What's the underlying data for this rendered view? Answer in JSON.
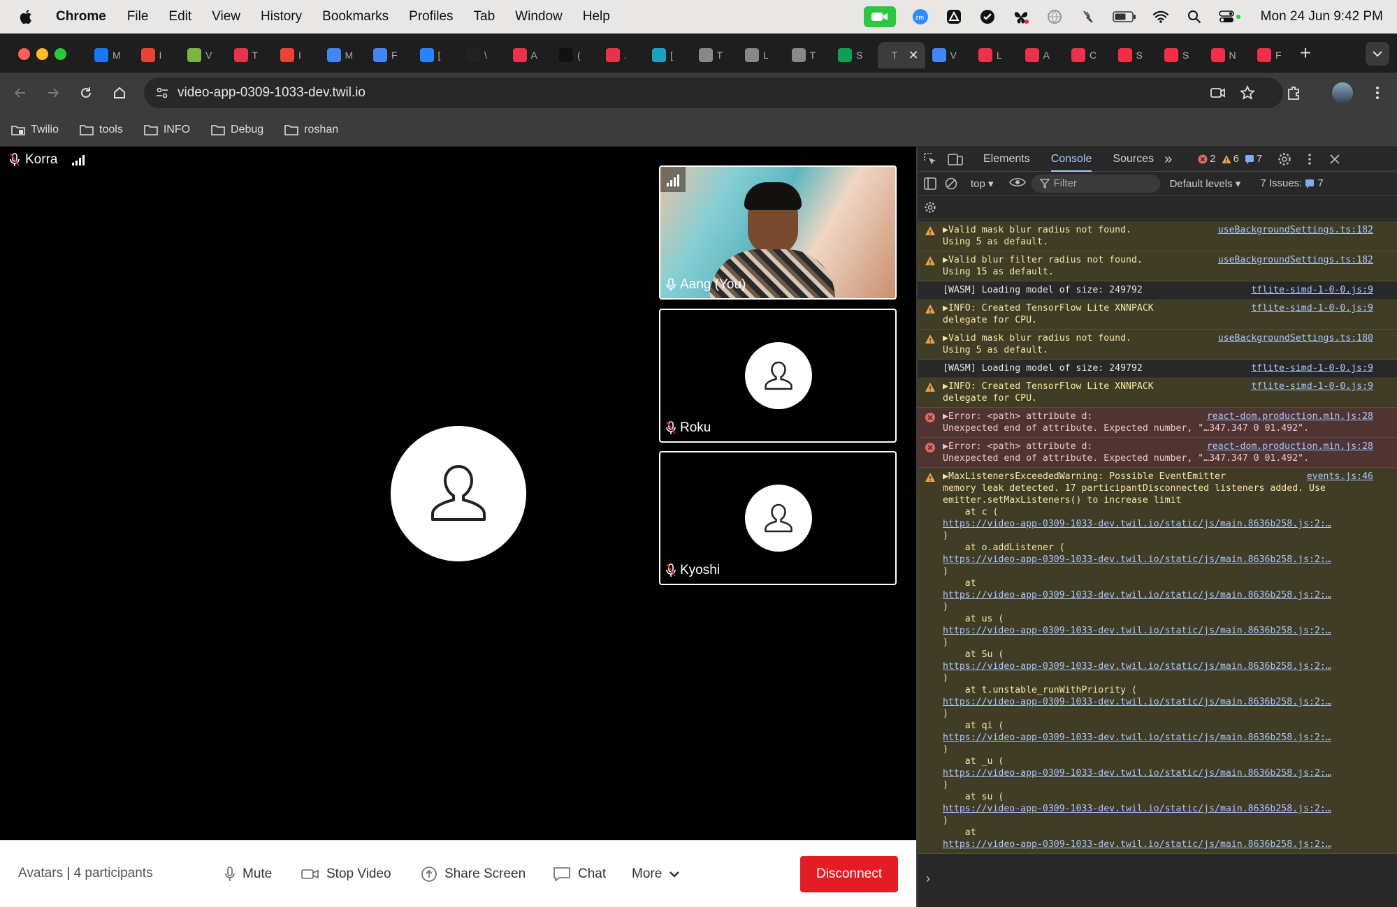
{
  "menubar": {
    "app_name": "Chrome",
    "items": [
      "File",
      "Edit",
      "View",
      "History",
      "Bookmarks",
      "Profiles",
      "Tab",
      "Window",
      "Help"
    ],
    "clock": "Mon 24 Jun  9:42 PM"
  },
  "tabs": [
    {
      "title": "M",
      "icon": "meta-icon",
      "color": "#1877f2"
    },
    {
      "title": "I",
      "icon": "gmail-icon",
      "color": "#ea4335"
    },
    {
      "title": "V",
      "icon": "pen-icon",
      "color": "#7cb342"
    },
    {
      "title": "T",
      "icon": "target-icon",
      "color": "#e8334a"
    },
    {
      "title": "I",
      "icon": "gmail-icon",
      "color": "#ea4335"
    },
    {
      "title": "M",
      "icon": "docs-icon",
      "color": "#4285f4"
    },
    {
      "title": "F",
      "icon": "docs-icon",
      "color": "#4285f4"
    },
    {
      "title": "[",
      "icon": "jira-icon",
      "color": "#2684ff"
    },
    {
      "title": "\\",
      "icon": "k-icon",
      "color": "#222222"
    },
    {
      "title": "A",
      "icon": "target-icon",
      "color": "#e8334a"
    },
    {
      "title": "(",
      "icon": "github-icon",
      "color": "#111111"
    },
    {
      "title": ".",
      "icon": "target-icon",
      "color": "#e8334a"
    },
    {
      "title": "[",
      "icon": "calendar-icon",
      "color": "#1da1c1"
    },
    {
      "title": "T",
      "icon": "globe-icon",
      "color": "#888888"
    },
    {
      "title": "L",
      "icon": "globe-icon",
      "color": "#888888"
    },
    {
      "title": "T",
      "icon": "globe-icon",
      "color": "#888888"
    },
    {
      "title": "S",
      "icon": "sheets-icon",
      "color": "#0f9d58"
    },
    {
      "title": "T",
      "icon": "",
      "color": "#3c3c3c",
      "active": true
    },
    {
      "title": "V",
      "icon": "docs-icon",
      "color": "#4285f4"
    },
    {
      "title": "L",
      "icon": "target-icon",
      "color": "#e8334a"
    },
    {
      "title": "A",
      "icon": "target-icon",
      "color": "#e8334a"
    },
    {
      "title": "C",
      "icon": "target-icon",
      "color": "#e8334a"
    },
    {
      "title": "S",
      "icon": "twilio-icon",
      "color": "#f22f46"
    },
    {
      "title": "S",
      "icon": "twilio-icon",
      "color": "#f22f46"
    },
    {
      "title": "N",
      "icon": "twilio-icon",
      "color": "#f22f46"
    },
    {
      "title": "F",
      "icon": "twilio-icon",
      "color": "#f22f46"
    }
  ],
  "omnibox": {
    "url": "video-app-0309-1033-dev.twil.io"
  },
  "bookmarks": [
    {
      "label": "Twilio",
      "icon": "folder-group-icon"
    },
    {
      "label": "tools",
      "icon": "folder-icon"
    },
    {
      "label": "INFO",
      "icon": "folder-icon"
    },
    {
      "label": "Debug",
      "icon": "folder-icon"
    },
    {
      "label": "roshan",
      "icon": "folder-icon"
    }
  ],
  "room": {
    "self_name": "Korra",
    "participants": [
      {
        "name": "Aang (You)",
        "video": true
      },
      {
        "name": "Roku",
        "video": false
      },
      {
        "name": "Kyoshi",
        "video": false
      }
    ],
    "room_name": "Avatars",
    "participant_count": "4 participants"
  },
  "controls": {
    "mute": "Mute",
    "stop_video": "Stop Video",
    "share_screen": "Share Screen",
    "chat": "Chat",
    "more": "More",
    "disconnect": "Disconnect"
  },
  "colors": {
    "disconnect": "#e31c25",
    "devtools_accent": "#a8c7fa"
  },
  "devtools": {
    "tabs": [
      "Elements",
      "Console",
      "Sources"
    ],
    "active_tab": "Console",
    "error_count": "2",
    "warning_count": "6",
    "info_count": "7",
    "context": "top",
    "filter_placeholder": "Filter",
    "levels": "Default levels",
    "issues_label": "7 Issues:",
    "issues_count": "7",
    "logs": [
      {
        "level": "warn",
        "msg": "▶Valid mask blur radius not found.\nUsing 5 as default.",
        "src": "useBackgroundSettings.ts:182"
      },
      {
        "level": "warn",
        "msg": "▶Valid blur filter radius not found.\nUsing 15 as default.",
        "src": "useBackgroundSettings.ts:182"
      },
      {
        "level": "info",
        "msg": "[WASM] Loading model of size: 249792",
        "src": "tflite-simd-1-0-0.js:9"
      },
      {
        "level": "warn",
        "msg": "▶INFO: Created TensorFlow Lite XNNPACK\ndelegate for CPU.",
        "src": "tflite-simd-1-0-0.js:9"
      },
      {
        "level": "warn",
        "msg": "▶Valid mask blur radius not found.\nUsing 5 as default.",
        "src": "useBackgroundSettings.ts:180"
      },
      {
        "level": "info",
        "msg": "[WASM] Loading model of size: 249792",
        "src": "tflite-simd-1-0-0.js:9"
      },
      {
        "level": "warn",
        "msg": "▶INFO: Created TensorFlow Lite XNNPACK\ndelegate for CPU.",
        "src": "tflite-simd-1-0-0.js:9"
      },
      {
        "level": "err",
        "msg": "▶Error: <path> attribute d:\nUnexpected end of attribute. Expected number, \"…347.347 0 01.492\".",
        "src": "react-dom.production.min.js:28"
      },
      {
        "level": "err",
        "msg": "▶Error: <path> attribute d:\nUnexpected end of attribute. Expected number, \"…347.347 0 01.492\".",
        "src": "react-dom.production.min.js:28"
      },
      {
        "level": "warn",
        "msg": "▶MaxListenersExceededWarning: Possible EventEmitter\nmemory leak detected. 17 participantDisconnected listeners added. Use\nemitter.setMaxListeners() to increase limit",
        "src": "events.js:46",
        "stack": [
          {
            "at": "    at c (",
            "url": "https://video-app-0309-1033-dev.twil.io/static/js/main.8636b258.js:2:…"
          },
          {
            "at": "    at o.addListener (",
            "url": "https://video-app-0309-1033-dev.twil.io/static/js/main.8636b258.js:2:…"
          },
          {
            "at": "    at",
            "url": "https://video-app-0309-1033-dev.twil.io/static/js/main.8636b258.js:2:…"
          },
          {
            "at": "    at us (",
            "url": "https://video-app-0309-1033-dev.twil.io/static/js/main.8636b258.js:2:…"
          },
          {
            "at": "    at Su (",
            "url": "https://video-app-0309-1033-dev.twil.io/static/js/main.8636b258.js:2:…"
          },
          {
            "at": "    at t.unstable_runWithPriority (",
            "url": "https://video-app-0309-1033-dev.twil.io/static/js/main.8636b258.js:2:…"
          },
          {
            "at": "    at qi (",
            "url": "https://video-app-0309-1033-dev.twil.io/static/js/main.8636b258.js:2:…"
          },
          {
            "at": "    at _u (",
            "url": "https://video-app-0309-1033-dev.twil.io/static/js/main.8636b258.js:2:…"
          },
          {
            "at": "    at su (",
            "url": "https://video-app-0309-1033-dev.twil.io/static/js/main.8636b258.js:2:…"
          },
          {
            "at": "    at",
            "url": "https://video-app-0309-1033-dev.twil.io/static/js/main.8636b258.js:2:…"
          }
        ]
      }
    ],
    "prompt": "›"
  }
}
